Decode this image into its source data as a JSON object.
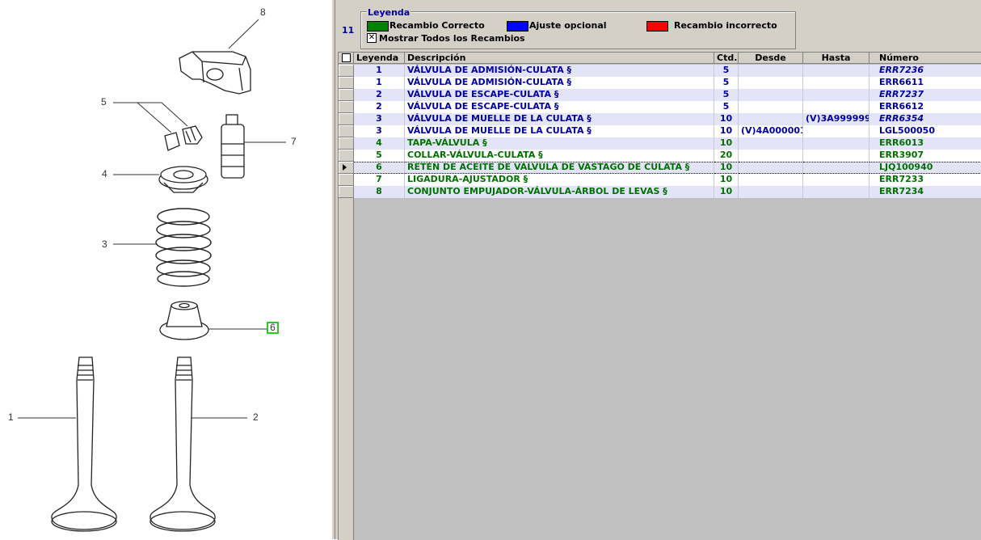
{
  "diagram": {
    "callouts": [
      "1",
      "2",
      "3",
      "4",
      "5",
      "6",
      "7",
      "8"
    ],
    "highlighted": "6"
  },
  "topbar": {
    "item_count": "11",
    "legend": {
      "title": "Leyenda",
      "items": [
        {
          "label": "Recambio Correcto",
          "color": "#008000"
        },
        {
          "label": "Ajuste opcional",
          "color": "#0000ff"
        },
        {
          "label": "Recambio incorrecto",
          "color": "#ff0000"
        }
      ],
      "show_all_label": "Mostrar Todos los Recambios",
      "show_all_checked": true,
      "check_mark": "✕"
    }
  },
  "grid": {
    "columns": [
      "Leyenda",
      "Descripción",
      "Ctd.",
      "Desde",
      "Hasta",
      "Número"
    ],
    "header_checkbox": false,
    "rows": [
      {
        "leyenda": "1",
        "desc": "VÁLVULA DE ADMISIÓN-CULATA §",
        "ctd": "5",
        "desde": "",
        "hasta": "",
        "numero": "ERR7236",
        "numero_italic": true,
        "color": "blue",
        "shade": true
      },
      {
        "leyenda": "1",
        "desc": "VÁLVULA DE ADMISIÓN-CULATA §",
        "ctd": "5",
        "desde": "",
        "hasta": "",
        "numero": "ERR6611",
        "numero_italic": false,
        "color": "blue",
        "shade": false
      },
      {
        "leyenda": "2",
        "desc": "VÁLVULA DE ESCAPE-CULATA §",
        "ctd": "5",
        "desde": "",
        "hasta": "",
        "numero": "ERR7237",
        "numero_italic": true,
        "color": "blue",
        "shade": true
      },
      {
        "leyenda": "2",
        "desc": "VÁLVULA DE ESCAPE-CULATA §",
        "ctd": "5",
        "desde": "",
        "hasta": "",
        "numero": "ERR6612",
        "numero_italic": false,
        "color": "blue",
        "shade": false
      },
      {
        "leyenda": "3",
        "desc": "VÁLVULA DE MUELLE DE LA CULATA §",
        "ctd": "10",
        "desde": "",
        "hasta": "(V)3A999999",
        "numero": "ERR6354",
        "numero_italic": true,
        "color": "blue",
        "shade": true
      },
      {
        "leyenda": "3",
        "desc": "VÁLVULA DE MUELLE DE LA CULATA §",
        "ctd": "10",
        "desde": "(V)4A000001",
        "hasta": "",
        "numero": "LGL500050",
        "numero_italic": false,
        "color": "blue",
        "shade": false
      },
      {
        "leyenda": "4",
        "desc": "TAPA-VÁLVULA §",
        "ctd": "10",
        "desde": "",
        "hasta": "",
        "numero": "ERR6013",
        "numero_italic": false,
        "color": "green",
        "shade": true
      },
      {
        "leyenda": "5",
        "desc": "COLLAR-VÁLVULA-CULATA §",
        "ctd": "20",
        "desde": "",
        "hasta": "",
        "numero": "ERR3907",
        "numero_italic": false,
        "color": "green",
        "shade": false
      },
      {
        "leyenda": "6",
        "desc": "RETÉN DE ACEITE DE VÁLVULA DE VÁSTAGO DE CULATA §",
        "ctd": "10",
        "desde": "",
        "hasta": "",
        "numero": "LJQ100940",
        "numero_italic": false,
        "color": "green",
        "shade": true,
        "current": true
      },
      {
        "leyenda": "7",
        "desc": "LIGADURA-AJUSTADOR §",
        "ctd": "10",
        "desde": "",
        "hasta": "",
        "numero": "ERR7233",
        "numero_italic": false,
        "color": "green",
        "shade": false
      },
      {
        "leyenda": "8",
        "desc": "CONJUNTO EMPUJADOR-VÁLVULA-ÁRBOL DE LEVAS §",
        "ctd": "10",
        "desde": "",
        "hasta": "",
        "numero": "ERR7234",
        "numero_italic": false,
        "color": "green",
        "shade": true
      }
    ]
  }
}
